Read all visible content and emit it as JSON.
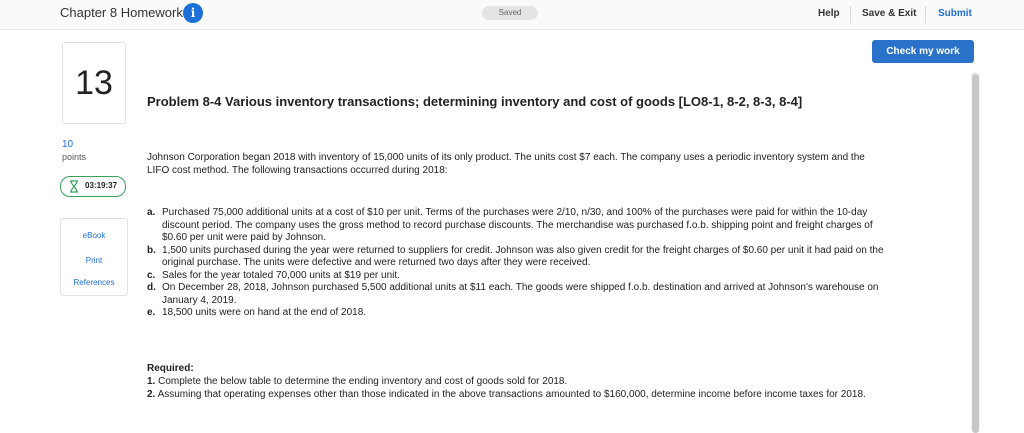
{
  "header": {
    "title": "Chapter 8 Homework",
    "info_icon": "info-icon",
    "saved_label": "Saved",
    "help_label": "Help",
    "save_exit_label": "Save & Exit",
    "submit_label": "Submit",
    "accent_color": "#1b6fd6"
  },
  "toolbar": {
    "check_work_label": "Check my work",
    "button_color": "#2a72c9"
  },
  "sidebar": {
    "question_number": "13",
    "points_value": "10",
    "points_label": "points",
    "timer": "03:19:37",
    "timer_icon": "hourglass-icon",
    "resources": [
      "eBook",
      "Print",
      "References"
    ]
  },
  "problem": {
    "title": "Problem 8-4 Various inventory transactions; determining inventory and cost of goods [LO8-1, 8-2, 8-3, 8-4]",
    "intro": "Johnson Corporation began 2018 with inventory of 15,000 units of its only product. The units cost $7 each. The company uses a periodic inventory system and the LIFO cost method. The following transactions occurred during 2018:",
    "items": [
      {
        "letter": "a.",
        "text": "Purchased 75,000 additional units at a cost of $10 per unit. Terms of the purchases were 2/10, n/30, and 100% of the purchases were paid for within the 10-day discount period. The company uses the gross method to record purchase discounts. The merchandise was purchased f.o.b. shipping point and freight charges of $0.60 per unit were paid by Johnson."
      },
      {
        "letter": "b.",
        "text": "1,500 units purchased during the year were returned to suppliers for credit. Johnson was also given credit for the freight charges of $0.60 per unit it had paid on the original purchase. The units were defective and were returned two days after they were received."
      },
      {
        "letter": "c.",
        "text": "Sales for the year totaled 70,000 units at $19 per unit."
      },
      {
        "letter": "d.",
        "text": "On December 28, 2018, Johnson purchased 5,500 additional units at $11 each. The goods were shipped f.o.b. destination and arrived at Johnson's warehouse on January 4, 2019."
      },
      {
        "letter": "e.",
        "text": "18,500 units were on hand at the end of 2018."
      }
    ],
    "required_label": "Required:",
    "requirements": [
      {
        "num": "1.",
        "text": "Complete the below table to determine the ending inventory and cost of goods sold for 2018."
      },
      {
        "num": "2.",
        "text": "Assuming that operating expenses other than those indicated in the above transactions amounted to $160,000, determine income before income taxes for 2018."
      }
    ]
  }
}
